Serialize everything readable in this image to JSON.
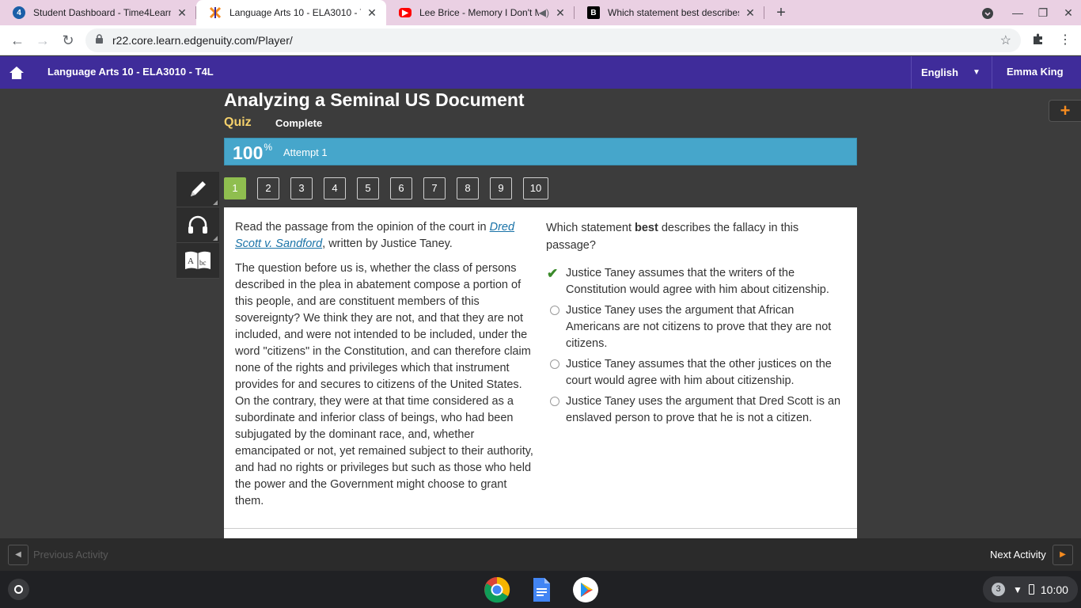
{
  "browser": {
    "tabs": [
      {
        "title": "Student Dashboard - Time4Learning",
        "favicon": "time4learning-icon",
        "active": false
      },
      {
        "title": "Language Arts 10 - ELA3010 - T4L",
        "favicon": "edgenuity-icon",
        "active": true
      },
      {
        "title": "Lee Brice - Memory I Don't Mess With",
        "favicon": "youtube-icon",
        "active": false,
        "muted": true
      },
      {
        "title": "Which statement best describes",
        "favicon": "brainly-icon",
        "active": false
      }
    ],
    "new_tab_label": "+",
    "url": "r22.core.learn.edgenuity.com/Player/"
  },
  "header": {
    "course_title": "Language Arts 10 - ELA3010 - T4L",
    "language": "English",
    "user": "Emma King",
    "color": "#3f2c9a"
  },
  "activity": {
    "title": "Analyzing a Seminal US Document",
    "type": "Quiz",
    "status": "Complete",
    "score": "100",
    "score_unit": "%",
    "attempt": "Attempt 1",
    "score_bar_color": "#46a6cb",
    "accent_color": "#f58b1f"
  },
  "tools": [
    {
      "name": "pencil-icon"
    },
    {
      "name": "headphones-icon"
    },
    {
      "name": "dictionary-icon"
    }
  ],
  "questions": {
    "numbers": [
      "1",
      "2",
      "3",
      "4",
      "5",
      "6",
      "7",
      "8",
      "9",
      "10"
    ],
    "current": "1",
    "current_color": "#8fbe4f"
  },
  "passage": {
    "intro_prefix": "Read the passage from the opinion of the court in ",
    "intro_link": "Dred Scott v. Sandford",
    "intro_suffix": ", written by Justice Taney.",
    "body": "The question before us is, whether the class of persons described in the plea in abatement compose a portion of this people, and are constituent members of this sovereignty? We think they are not, and that they are not included, and were not intended to be included, under the word \"citizens\" in the Constitution, and can therefore claim none of the rights and privileges which that instrument provides for and secures to citizens of the United States. On the contrary, they were at that time considered as a subordinate and inferior class of beings, who had been subjugated by the dominant race, and, whether emancipated or not, yet remained subject to their authority, and had no rights or privileges but such as those who held the power and the Government might choose to grant them."
  },
  "question": {
    "prompt_prefix": "Which statement ",
    "prompt_bold": "best",
    "prompt_suffix": " describes the fallacy in this passage?",
    "options": [
      {
        "text": "Justice Taney assumes that the writers of the Constitution would agree with him about citizenship.",
        "selected": true
      },
      {
        "text": "Justice Taney uses the argument that African Americans are not citizens to prove that they are not citizens.",
        "selected": false
      },
      {
        "text": "Justice Taney assumes that the other justices on the court would agree with him about citizenship.",
        "selected": false
      },
      {
        "text": "Justice Taney uses the argument that Dred Scott is an enslaved person to prove that he is not a citizen.",
        "selected": false
      }
    ]
  },
  "footer": {
    "previous_label": "Previous Activity",
    "next_label": "Next Activity"
  },
  "shelf": {
    "notification_count": "3",
    "time": "10:00"
  }
}
